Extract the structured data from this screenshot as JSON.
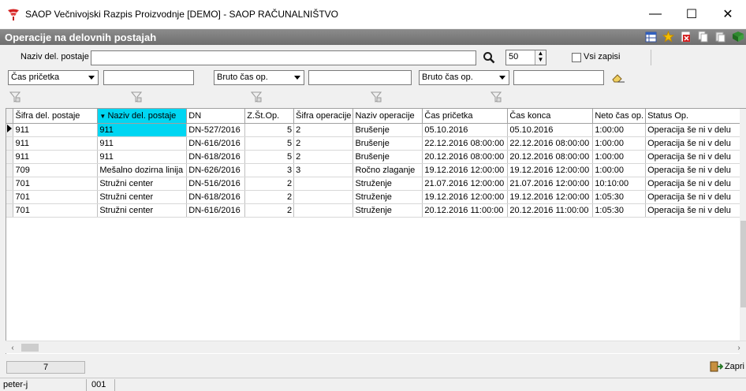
{
  "window": {
    "title": "SAOP  Večnivojski Razpis Proizvodnje [DEMO] - SAOP RAČUNALNIŠTVO",
    "minimize": "—",
    "maximize": "☐",
    "close": "✕"
  },
  "header": {
    "title": "Operacije na delovnih postajah",
    "tools": [
      "table-icon",
      "star-icon",
      "red-x-icon",
      "copy-icon",
      "paste-icon",
      "book-icon"
    ]
  },
  "search": {
    "label": "Naziv del. postaje",
    "value": "",
    "count": "50",
    "vsi_label": "Vsi zapisi"
  },
  "filters": [
    {
      "field": "Čas pričetka",
      "value": ""
    },
    {
      "field": "Bruto čas op.",
      "value": ""
    },
    {
      "field": "Bruto čas op.",
      "value": ""
    }
  ],
  "table": {
    "columns": [
      "Šifra del. postaje",
      "Naziv del. postaje",
      "DN",
      "Z.Št.Op.",
      "Šifra operacije",
      "Naziv operacije",
      "Čas pričetka",
      "Čas konca",
      "Neto čas op.",
      "Status Op."
    ],
    "sorted_column": "Naziv del. postaje",
    "rows": [
      [
        "911",
        "911",
        "DN-527/2016",
        "5",
        "2",
        "Brušenje",
        "05.10.2016",
        "05.10.2016",
        "1:00:00",
        "Operacija še ni v delu"
      ],
      [
        "911",
        "911",
        "DN-616/2016",
        "5",
        "2",
        "Brušenje",
        "22.12.2016 08:00:00",
        "22.12.2016 08:00:00",
        "1:00:00",
        "Operacija še ni v delu"
      ],
      [
        "911",
        "911",
        "DN-618/2016",
        "5",
        "2",
        "Brušenje",
        "20.12.2016 08:00:00",
        "20.12.2016 08:00:00",
        "1:00:00",
        "Operacija še ni v delu"
      ],
      [
        "709",
        "Mešalno dozirna linija",
        "DN-626/2016",
        "3",
        "3",
        "Ročno zlaganje",
        "19.12.2016 12:00:00",
        "19.12.2016 12:00:00",
        "1:00:00",
        "Operacija še ni v delu"
      ],
      [
        "701",
        "Stružni center",
        "DN-516/2016",
        "2",
        "",
        "Struženje",
        "21.07.2016 12:00:00",
        "21.07.2016 12:00:00",
        "10:10:00",
        "Operacija še ni v delu"
      ],
      [
        "701",
        "Stružni center",
        "DN-618/2016",
        "2",
        "",
        "Struženje",
        "19.12.2016 12:00:00",
        "19.12.2016 12:00:00",
        "1:05:30",
        "Operacija še ni v delu"
      ],
      [
        "701",
        "Stružni center",
        "DN-616/2016",
        "2",
        "",
        "Struženje",
        "20.12.2016 11:00:00",
        "20.12.2016 11:00:00",
        "1:05:30",
        "Operacija še ni v delu"
      ]
    ]
  },
  "footer": {
    "record_count": "7",
    "close_label": "Zapri"
  },
  "status": {
    "user": "peter-j",
    "code": "001"
  }
}
